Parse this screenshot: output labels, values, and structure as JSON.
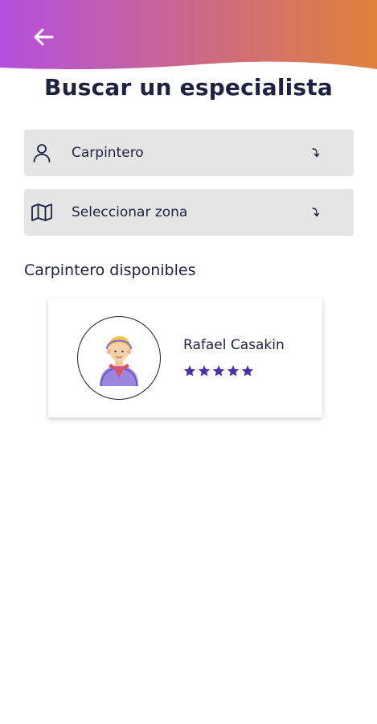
{
  "header": {
    "back_icon": "arrow-left-icon",
    "gradient_start": "#b44fe0",
    "gradient_end": "#e0813a"
  },
  "page": {
    "title": "Buscar un especialista"
  },
  "filters": {
    "especialidad": {
      "icon": "person-icon",
      "value": "Carpintero",
      "arrow_icon": "dropdown-arrow-icon"
    },
    "zona": {
      "icon": "map-icon",
      "value": "Seleccionar zona",
      "arrow_icon": "dropdown-arrow-icon"
    }
  },
  "results": {
    "section_title": "Carpintero disponibles",
    "specialists": [
      {
        "name": "Rafael Casakin",
        "avatar_icon": "worker-avatar-icon",
        "rating": 5,
        "rating_max": 5,
        "star_color": "#4a2fa8"
      }
    ]
  }
}
